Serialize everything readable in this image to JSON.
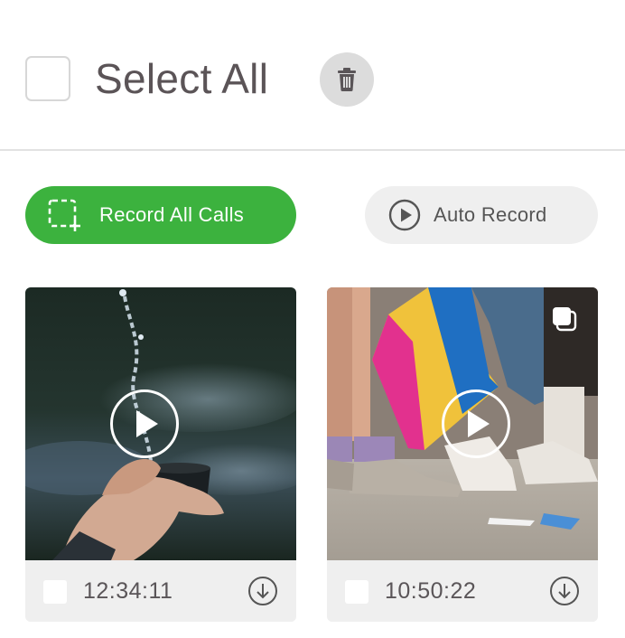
{
  "header": {
    "select_all_label": "Select All",
    "delete_icon": "trash-icon"
  },
  "actions": {
    "record_all": {
      "label": "Record All Calls",
      "icon": "add-selection-icon",
      "color": "#3cb23e"
    },
    "auto_record": {
      "label": "Auto Record",
      "icon": "play-circle-icon"
    }
  },
  "items": [
    {
      "timestamp": "12:34:11",
      "thumbnail": "hand-holding-cup-with-water-splash",
      "icons": [
        "play-icon",
        "download-icon"
      ]
    },
    {
      "timestamp": "10:50:22",
      "thumbnail": "feet-walking-with-flag",
      "icons": [
        "play-icon",
        "download-icon",
        "stacked-squares-icon"
      ]
    }
  ],
  "colors": {
    "accent": "#3cb23e",
    "muted_bg": "#efefef",
    "text": "#5b5457"
  }
}
